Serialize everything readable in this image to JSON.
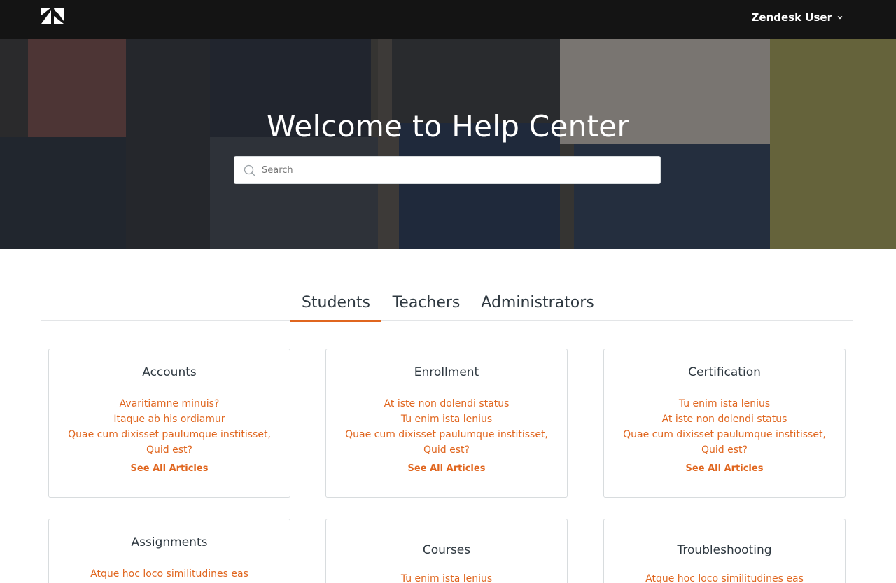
{
  "header": {
    "user_label": "Zendesk User"
  },
  "hero": {
    "title": "Welcome to Help Center",
    "search_placeholder": "Search"
  },
  "tabs": [
    {
      "label": "Students",
      "active": true
    },
    {
      "label": "Teachers",
      "active": false
    },
    {
      "label": "Administrators",
      "active": false
    }
  ],
  "cards": [
    {
      "title": "Accounts",
      "articles": [
        "Avaritiamne minuis?",
        "Itaque ab his ordiamur",
        "Quae cum dixisset paulumque institisset, Quid est?"
      ],
      "see_all": "See All Articles"
    },
    {
      "title": "Enrollment",
      "articles": [
        "At iste non dolendi status",
        "Tu enim ista lenius",
        "Quae cum dixisset paulumque institisset, Quid est?"
      ],
      "see_all": "See All Articles"
    },
    {
      "title": "Certification",
      "articles": [
        "Tu enim ista lenius",
        "At iste non dolendi status",
        "Quae cum dixisset paulumque institisset, Quid est?"
      ],
      "see_all": "See All Articles"
    },
    {
      "title": "Assignments",
      "articles": [
        "Atque hoc loco similitudines eas"
      ]
    },
    {
      "title": "Courses",
      "articles": [
        "Tu enim ista lenius"
      ]
    },
    {
      "title": "Troubleshooting",
      "articles": [
        "Atque hoc loco similitudines eas"
      ]
    }
  ],
  "colors": {
    "accent": "#e0661f",
    "topbar": "#141414"
  },
  "icons": {
    "logo": "zendesk-logo-icon",
    "user_menu": "chevron-down-icon",
    "search": "search-icon"
  }
}
